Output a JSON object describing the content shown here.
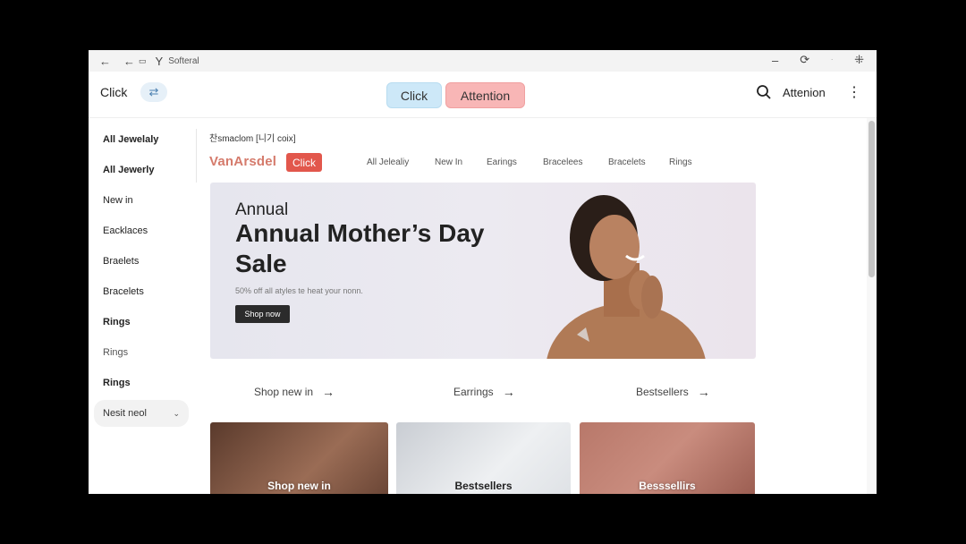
{
  "chrome": {
    "back_icon": "arrow-left",
    "title": "Softeral",
    "icons": [
      "back-arrow",
      "tab-icon",
      "bookmark-icon"
    ]
  },
  "topbar": {
    "brand": "Click",
    "pill_click": "Click",
    "pill_attention": "Attention",
    "right_label": "Attenion"
  },
  "sidebar": {
    "items": [
      {
        "label": "All Jewelaly"
      },
      {
        "label": "All Jewerly"
      },
      {
        "label": "New in"
      },
      {
        "label": "Eacklaces"
      },
      {
        "label": "Braelets"
      },
      {
        "label": "Bracelets"
      },
      {
        "label": "Rings"
      },
      {
        "label": "Rings"
      },
      {
        "label": "Rings"
      }
    ],
    "select_value": "Nesit neol"
  },
  "content": {
    "crumb": "찬smaclom [니기 coix]",
    "logo": "VanArsdel",
    "logo_button": "Click",
    "nav": [
      "All Jelealiy",
      "New In",
      "Earings",
      "Bracelees",
      "Bracelets",
      "Rings"
    ],
    "hero": {
      "kicker": "Annual",
      "headline": "Annual Mother’s Day Sale",
      "subtitle": "50% off all atyles te heat your nonn.",
      "cta": "Shop now"
    },
    "links": [
      "Shop new in",
      "Earrings",
      "Bestsellers"
    ],
    "cards": [
      "Shop new in",
      "Bestsellers",
      "Besssellirs"
    ]
  }
}
